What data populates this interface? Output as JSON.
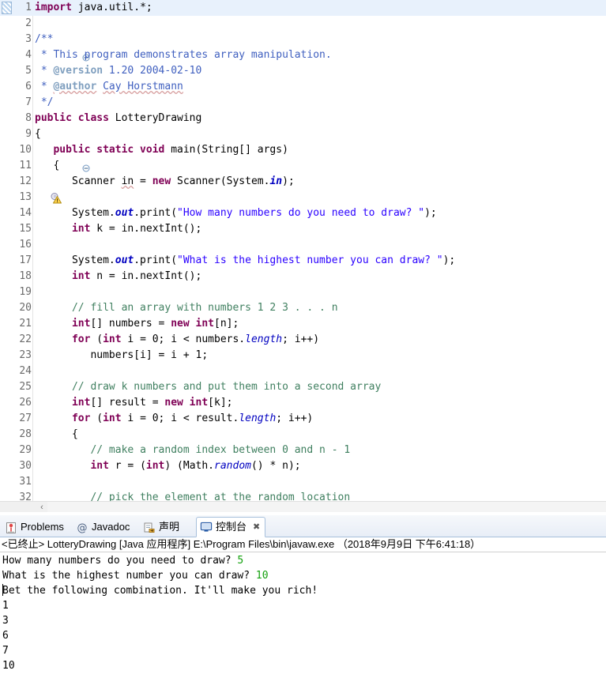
{
  "editor": {
    "name": "java-source-editor",
    "language": "Java",
    "highlighted_line": 1,
    "warning_line": 12,
    "fold_lines": [
      3,
      10
    ],
    "lines": [
      {
        "n": "1",
        "text": "import java.util.*;"
      },
      {
        "n": "2",
        "text": ""
      },
      {
        "n": "3",
        "text": "/**"
      },
      {
        "n": "4",
        "text": " * This program demonstrates array manipulation."
      },
      {
        "n": "5",
        "text": " * @version 1.20 2004-02-10"
      },
      {
        "n": "6",
        "text": " * @author Cay Horstmann"
      },
      {
        "n": "7",
        "text": " */"
      },
      {
        "n": "8",
        "text": "public class LotteryDrawing"
      },
      {
        "n": "9",
        "text": "{"
      },
      {
        "n": "10",
        "text": "   public static void main(String[] args)"
      },
      {
        "n": "11",
        "text": "   {"
      },
      {
        "n": "12",
        "text": "      Scanner in = new Scanner(System.in);"
      },
      {
        "n": "13",
        "text": ""
      },
      {
        "n": "14",
        "text": "      System.out.print(\"How many numbers do you need to draw? \");"
      },
      {
        "n": "15",
        "text": "      int k = in.nextInt();"
      },
      {
        "n": "16",
        "text": ""
      },
      {
        "n": "17",
        "text": "      System.out.print(\"What is the highest number you can draw? \");"
      },
      {
        "n": "18",
        "text": "      int n = in.nextInt();"
      },
      {
        "n": "19",
        "text": ""
      },
      {
        "n": "20",
        "text": "      // fill an array with numbers 1 2 3 . . . n"
      },
      {
        "n": "21",
        "text": "      int[] numbers = new int[n];"
      },
      {
        "n": "22",
        "text": "      for (int i = 0; i < numbers.length; i++)"
      },
      {
        "n": "23",
        "text": "         numbers[i] = i + 1;"
      },
      {
        "n": "24",
        "text": ""
      },
      {
        "n": "25",
        "text": "      // draw k numbers and put them into a second array"
      },
      {
        "n": "26",
        "text": "      int[] result = new int[k];"
      },
      {
        "n": "27",
        "text": "      for (int i = 0; i < result.length; i++)"
      },
      {
        "n": "28",
        "text": "      {"
      },
      {
        "n": "29",
        "text": "         // make a random index between 0 and n - 1"
      },
      {
        "n": "30",
        "text": "         int r = (int) (Math.random() * n);"
      },
      {
        "n": "31",
        "text": ""
      },
      {
        "n": "32",
        "text": "         // pick the element at the random location"
      }
    ],
    "hscroll": {
      "left_arrow": "‹"
    }
  },
  "bottom_panel": {
    "tabs": [
      {
        "label": "Problems",
        "icon": "problems-icon",
        "active": false,
        "closable": false
      },
      {
        "label": "Javadoc",
        "icon": "javadoc-icon",
        "active": false,
        "closable": false
      },
      {
        "label": "声明",
        "icon": "declaration-icon",
        "active": false,
        "closable": false
      },
      {
        "label": "控制台",
        "icon": "console-icon",
        "active": true,
        "closable": true,
        "close_glyph": "✖"
      }
    ],
    "console": {
      "header": "<已终止> LotteryDrawing [Java 应用程序] E:\\Program Files\\bin\\javaw.exe （2018年9月9日 下午6:41:18）",
      "lines": [
        {
          "prompt": "How many numbers do you need to draw? ",
          "input": "5"
        },
        {
          "prompt": "What is the highest number you can draw? ",
          "input": "10"
        },
        {
          "prompt": "Bet the following combination. It'll make you rich!",
          "input": ""
        },
        {
          "prompt": "1",
          "input": ""
        },
        {
          "prompt": "3",
          "input": ""
        },
        {
          "prompt": "6",
          "input": ""
        },
        {
          "prompt": "7",
          "input": ""
        },
        {
          "prompt": "10",
          "input": ""
        }
      ]
    }
  },
  "colors": {
    "keyword": "#7f0055",
    "comment": "#3f7f5f",
    "javadoc": "#3f5fbf",
    "string": "#2a00ff",
    "static_field": "#0000c0",
    "line_highlight": "#e8f1fc",
    "console_input": "#13a10e",
    "tab_border": "#a7c0dc"
  }
}
